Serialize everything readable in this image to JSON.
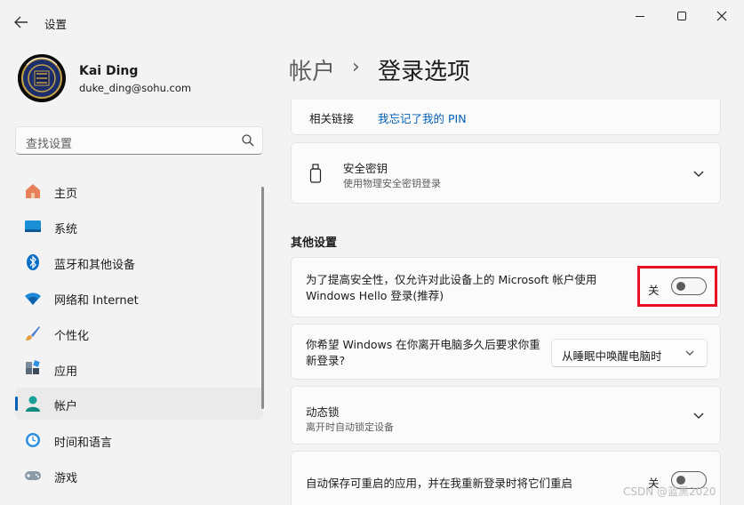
{
  "window": {
    "title": "设置",
    "back_icon": "arrow-left-icon",
    "controls": [
      "minimize-icon",
      "maximize-icon",
      "close-icon"
    ]
  },
  "profile": {
    "name": "Kai Ding",
    "email": "duke_ding@sohu.com",
    "avatar_icon": "inter-milan-logo"
  },
  "search": {
    "placeholder": "查找设置",
    "icon": "search-icon"
  },
  "nav": {
    "items": [
      {
        "label": "主页",
        "icon": "home-icon",
        "active": false
      },
      {
        "label": "系统",
        "icon": "system-display-icon",
        "active": false
      },
      {
        "label": "蓝牙和其他设备",
        "icon": "bluetooth-icon",
        "active": false
      },
      {
        "label": "网络和 Internet",
        "icon": "wifi-icon",
        "active": false
      },
      {
        "label": "个性化",
        "icon": "brush-icon",
        "active": false
      },
      {
        "label": "应用",
        "icon": "apps-icon",
        "active": false
      },
      {
        "label": "帐户",
        "icon": "account-icon",
        "active": true
      },
      {
        "label": "时间和语言",
        "icon": "time-language-icon",
        "active": false
      },
      {
        "label": "游戏",
        "icon": "gamepad-icon",
        "active": false
      }
    ]
  },
  "breadcrumb": {
    "parent": "帐户",
    "separator": "›",
    "current": "登录选项"
  },
  "related": {
    "label": "相关链接",
    "link": "我忘记了我的 PIN"
  },
  "security_key": {
    "title": "安全密钥",
    "description": "使用物理安全密钥登录"
  },
  "other_settings": {
    "heading": "其他设置",
    "hello_only": {
      "text": "为了提高安全性，仅允许对此设备上的 Microsoft 帐户使用 Windows Hello 登录(推荐)",
      "state_label": "关",
      "on": false
    },
    "require_signin": {
      "text": "你希望 Windows 在你离开电脑多久后要求你重新登录?",
      "selected": "从睡眠中唤醒电脑时"
    },
    "dynamic_lock": {
      "title": "动态锁",
      "description": "离开时自动锁定设备"
    },
    "auto_restart_apps": {
      "text": "自动保存可重启的应用，并在我重新登录时将它们重启",
      "state_label": "关",
      "on": false
    }
  },
  "colors": {
    "accent": "#005fb8",
    "highlight": "#e81123",
    "background": "#f3f3f3"
  },
  "watermark": "CSDN @蓝黑2020"
}
